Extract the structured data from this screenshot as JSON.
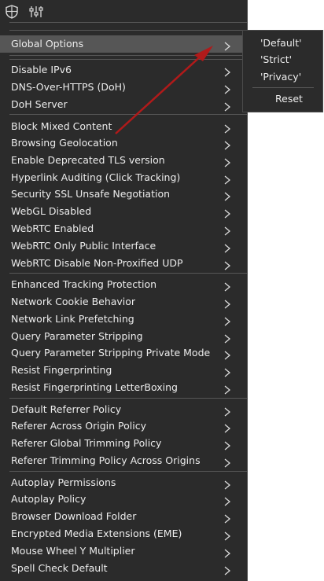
{
  "menu": {
    "items": [
      {
        "label": "Global Options"
      },
      {
        "label": "Disable IPv6"
      },
      {
        "label": "DNS-Over-HTTPS (DoH)"
      },
      {
        "label": "DoH Server"
      },
      {
        "label": "Block Mixed Content"
      },
      {
        "label": "Browsing Geolocation"
      },
      {
        "label": "Enable Deprecated TLS version"
      },
      {
        "label": "Hyperlink Auditing (Click Tracking)"
      },
      {
        "label": "Security SSL Unsafe Negotiation"
      },
      {
        "label": "WebGL  Disabled"
      },
      {
        "label": "WebRTC Enabled"
      },
      {
        "label": "WebRTC Only Public Interface"
      },
      {
        "label": "WebRTC Disable Non-Proxified UDP"
      },
      {
        "label": "Enhanced Tracking Protection"
      },
      {
        "label": "Network Cookie Behavior"
      },
      {
        "label": "Network Link Prefetching"
      },
      {
        "label": "Query Parameter Stripping"
      },
      {
        "label": "Query Parameter Stripping Private Mode"
      },
      {
        "label": "Resist Fingerprinting"
      },
      {
        "label": "Resist Fingerprinting LetterBoxing"
      },
      {
        "label": "Default Referrer Policy"
      },
      {
        "label": "Referer Across Origin Policy"
      },
      {
        "label": "Referer Global Trimming Policy"
      },
      {
        "label": "Referer Trimming Policy Across Origins"
      },
      {
        "label": "Autoplay Permissions"
      },
      {
        "label": "Autoplay Policy"
      },
      {
        "label": "Browser Download Folder"
      },
      {
        "label": "Encrypted Media Extensions (EME)"
      },
      {
        "label": "Mouse Wheel Y Multiplier"
      },
      {
        "label": "Spell Check Default"
      }
    ]
  },
  "submenu": {
    "options": [
      "'Default'",
      "'Strict'",
      "'Privacy'"
    ],
    "reset_label": "Reset"
  },
  "icons": {
    "toolbar": [
      "shield-grid-icon",
      "sliders-icon"
    ],
    "item_chevron": "chevron-right-icon"
  },
  "colors": {
    "menu_bg": "#2b2b2b",
    "highlight_bg": "#565656",
    "text": "#ececec",
    "annotation_arrow": "#b01a1a"
  }
}
